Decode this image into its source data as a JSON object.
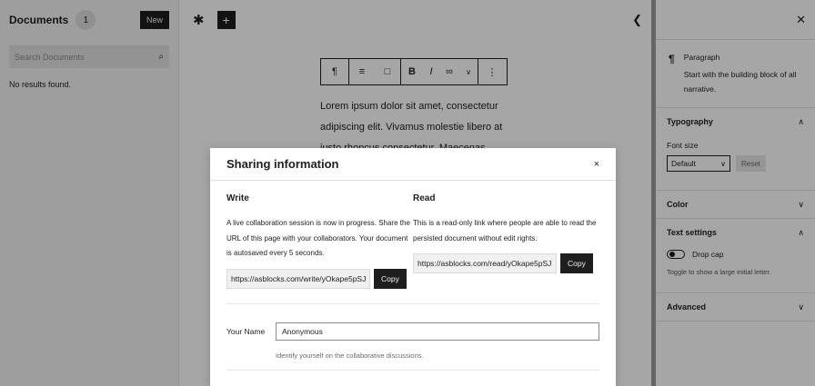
{
  "sidebar": {
    "title": "Documents",
    "count": "1",
    "new_label": "New",
    "search_placeholder": "Search Documents",
    "no_results": "No results found."
  },
  "toolbar": {
    "add_label": "+"
  },
  "block_toolbar": {
    "bold": "B",
    "italic": "I"
  },
  "editor": {
    "paragraph": "Lorem ipsum dolor sit amet, consectetur adipiscing elit. Vivamus molestie libero at justo rhoncus consectetur. Maecenas"
  },
  "settings": {
    "block_name": "Paragraph",
    "block_description": "Start with the building block of all narrative.",
    "typography_title": "Typography",
    "font_size_label": "Font size",
    "font_size_value": "Default",
    "reset_label": "Reset",
    "color_title": "Color",
    "text_settings_title": "Text settings",
    "drop_cap_label": "Drop cap",
    "drop_cap_help": "Toggle to show a large initial letter.",
    "advanced_title": "Advanced"
  },
  "modal": {
    "title": "Sharing information",
    "close": "×",
    "write": {
      "heading": "Write",
      "text": "A live collaboration session is now in progress. Share the URL of this page with your collaborators. Your document is autosaved every 5 seconds.",
      "url": "https://asblocks.com/write/yOkape5pSJ",
      "copy_label": "Copy"
    },
    "read": {
      "heading": "Read",
      "text": "This is a read-only link where people are able to read the persisted document without edit rights.",
      "url": "https://asblocks.com/read/yOkape5pSJ",
      "copy_label": "Copy"
    },
    "name_label": "Your Name",
    "name_value": "Anonymous",
    "name_help": "Identify yourself on the collaborative discussions."
  },
  "icons": {
    "search": "search-icon",
    "settings": "cog-icon",
    "share": "share-icon",
    "close": "close-icon",
    "paragraph": "paragraph-icon",
    "chevron": "chevron-icon"
  },
  "colors": {
    "dark": "#1e1e1e",
    "sidebar_bg": "#f3f3f3",
    "overlay": "rgba(0,0,0,0.35)"
  }
}
